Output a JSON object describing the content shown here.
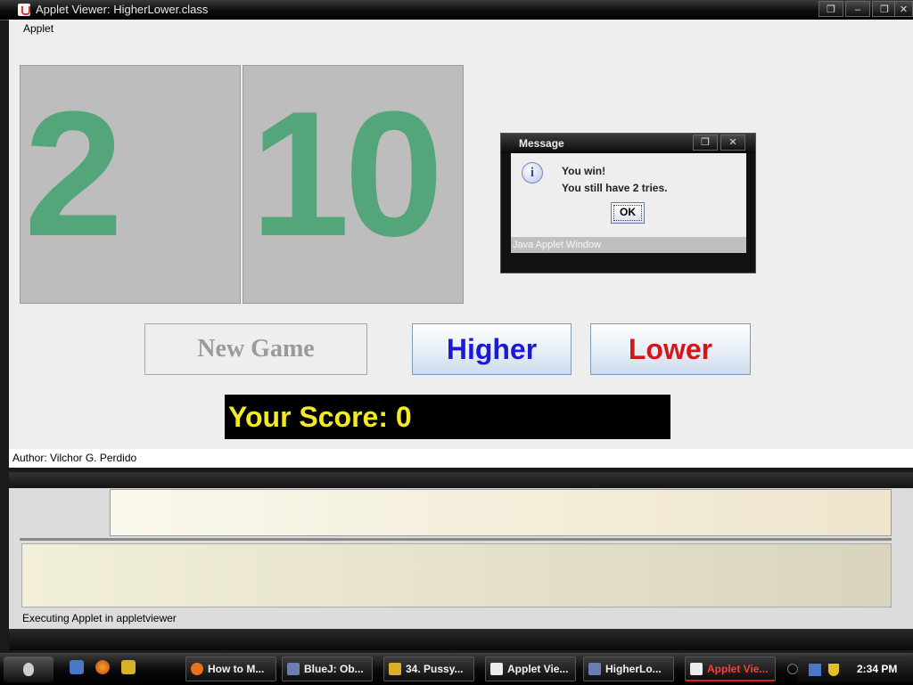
{
  "window": {
    "title": "Applet Viewer: HigherLower.class",
    "controls": [
      "❐",
      "–",
      "❐",
      "✕"
    ]
  },
  "menu": {
    "applet": "Applet"
  },
  "cards": {
    "left": "2",
    "right": "10"
  },
  "buttons": {
    "new_game": "New Game",
    "higher": "Higher",
    "lower": "Lower"
  },
  "score": {
    "label": "Your Score: 0"
  },
  "author": "Author: Vilchor G. Perdido",
  "dialog": {
    "title": "Message",
    "line1": "You win!",
    "line2": "You still have 2 tries.",
    "ok": "OK",
    "warning": "Java Applet Window",
    "icon": "information-icon"
  },
  "status": "Executing Applet in appletviewer",
  "taskbar": {
    "tasks": [
      {
        "label": "How to M...",
        "icon": "firefox-icon",
        "color": "#e8711f"
      },
      {
        "label": "BlueJ:  Ob...",
        "icon": "bluej-icon",
        "color": "#6a7fb0"
      },
      {
        "label": "34. Pussy...",
        "icon": "media-icon",
        "color": "#d7b02a"
      },
      {
        "label": "Applet Vie...",
        "icon": "java-icon",
        "color": "#ececec"
      },
      {
        "label": "HigherLo...",
        "icon": "bluej-icon",
        "color": "#6a7fb0"
      },
      {
        "label": "Applet Vie...",
        "icon": "java-icon",
        "color": "#ececec"
      }
    ],
    "clock": "2:34 PM"
  },
  "colors": {
    "card_number": "#55a57a",
    "higher_text": "#1a1ad6",
    "lower_text": "#d01818",
    "score_text": "#f2ea24"
  }
}
